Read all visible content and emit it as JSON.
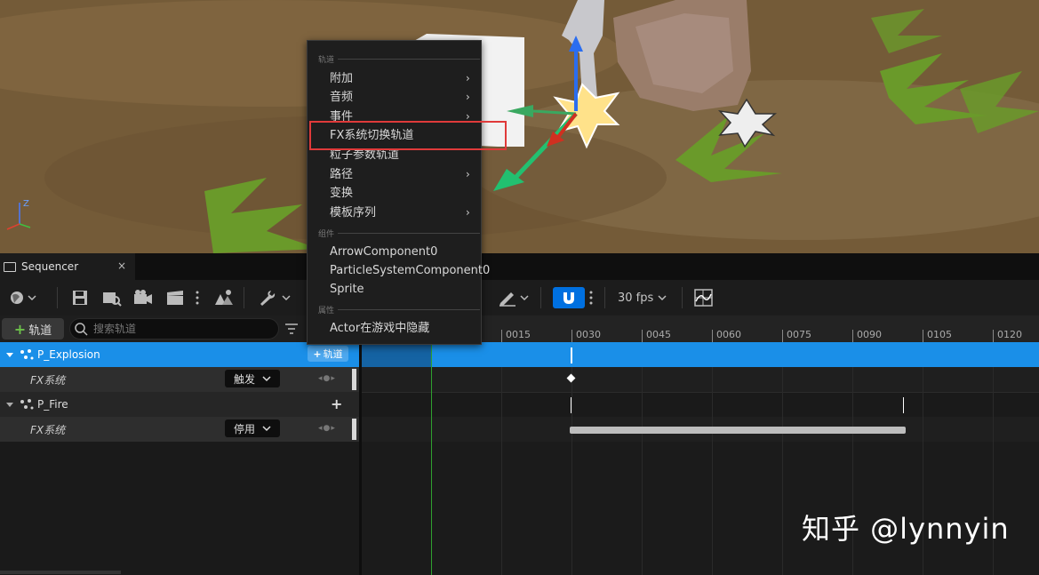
{
  "viewport": {
    "axis_z_label": "Z"
  },
  "sequencer_tab": {
    "title": "Sequencer",
    "close_label": "×"
  },
  "toolbar": {
    "fps_label": "30 fps"
  },
  "left_panel": {
    "add_track_label": "轨道",
    "search_placeholder": "搜索轨道",
    "rows": [
      {
        "name": "P_Explosion",
        "add_label": "轨道"
      },
      {
        "name": "FX系统",
        "dropdown": "触发"
      },
      {
        "name": "P_Fire",
        "add_label": "+"
      },
      {
        "name": "FX系统",
        "dropdown": "停用"
      }
    ]
  },
  "timeline": {
    "ticks": [
      "0015",
      "0030",
      "0045",
      "0060",
      "0075",
      "0090",
      "0105",
      "0120"
    ]
  },
  "context_menu": {
    "section_tracks": "轨道",
    "items_tracks": [
      "附加",
      "音频",
      "事件",
      "FX系统切换轨道",
      "粒子参数轨道",
      "路径",
      "变换",
      "模板序列"
    ],
    "section_components": "组件",
    "items_components": [
      "ArrowComponent0",
      "ParticleSystemComponent0",
      "Sprite"
    ],
    "section_properties": "属性",
    "items_properties": [
      "Actor在游戏中隐藏"
    ]
  },
  "watermark": "知乎 @lynnyin",
  "colors": {
    "selected_row": "#1a8fe8",
    "snap_button": "#0070e0",
    "highlight_box": "#e03a3a",
    "add_plus": "#6cc04a"
  }
}
